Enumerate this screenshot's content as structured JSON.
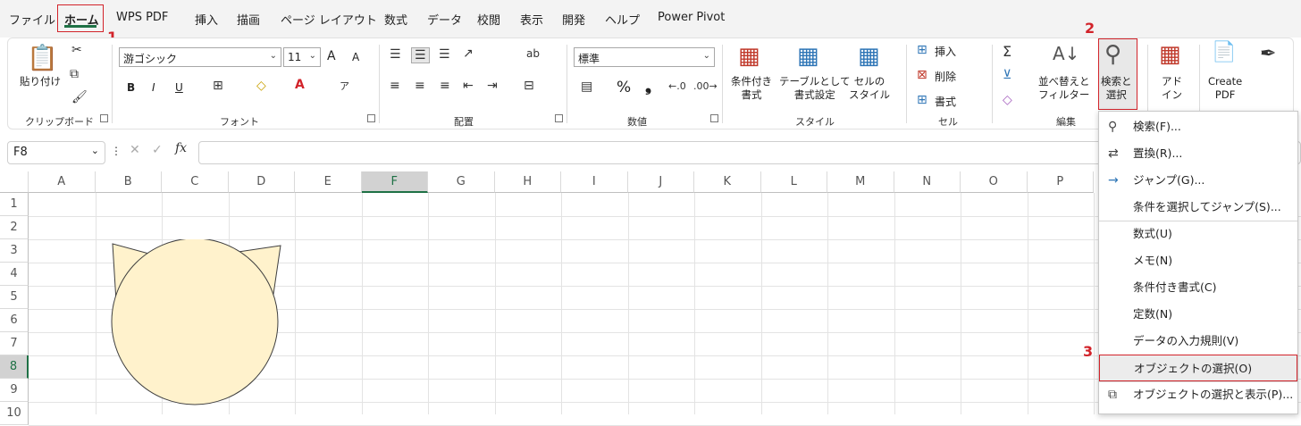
{
  "menu": {
    "tabs": [
      "ファイル",
      "ホーム",
      "WPS PDF",
      "挿入",
      "描画",
      "ページ レイアウト",
      "数式",
      "データ",
      "校閲",
      "表示",
      "開発",
      "ヘルプ",
      "Power Pivot"
    ]
  },
  "annotations": {
    "step1": "1",
    "step2": "2",
    "step3": "3"
  },
  "ribbon": {
    "clipboard": {
      "paste": "貼り付け",
      "group": "クリップボード"
    },
    "font": {
      "name": "游ゴシック",
      "size": "11",
      "bold": "B",
      "italic": "I",
      "underline": "U",
      "grow": "A",
      "shrink": "A",
      "group": "フォント"
    },
    "alignment": {
      "group": "配置"
    },
    "number": {
      "format": "標準",
      "percent": "%",
      "comma": "❟",
      "group": "数値"
    },
    "styles": {
      "cond": "条件付き\n書式",
      "table": "テーブルとして\n書式設定",
      "cell": "セルの\nスタイル",
      "group": "スタイル"
    },
    "cells": {
      "insert": "挿入",
      "delete": "削除",
      "format": "書式",
      "group": "セル"
    },
    "editing": {
      "sort": "並べ替えと\nフィルター",
      "find": "検索と\n選択",
      "group": "編集"
    },
    "addins": {
      "label": "アド\nイン"
    },
    "pdf": {
      "label": "Create\nPDF"
    }
  },
  "formula_bar": {
    "cell_ref": "F8",
    "fx": "fx",
    "value": ""
  },
  "grid": {
    "columns": [
      "A",
      "B",
      "C",
      "D",
      "E",
      "F",
      "G",
      "H",
      "I",
      "J",
      "K",
      "L",
      "M",
      "N",
      "O",
      "P"
    ],
    "rows": [
      "1",
      "2",
      "3",
      "4",
      "5",
      "6",
      "7",
      "8",
      "9",
      "10"
    ],
    "selected_column": "F",
    "selected_row": "8"
  },
  "shape": {
    "fill": "#fff2cc",
    "stroke": "#3f3f3f",
    "name": "cat-face-shape"
  },
  "dropdown": {
    "items": [
      {
        "label": "検索(F)...",
        "icon": "search-icon"
      },
      {
        "label": "置換(R)...",
        "icon": "replace-icon"
      },
      {
        "label": "ジャンプ(G)...",
        "icon": "arrow-right-icon"
      },
      {
        "label": "条件を選択してジャンプ(S)...",
        "icon": ""
      },
      {
        "label": "数式(U)",
        "icon": ""
      },
      {
        "label": "メモ(N)",
        "icon": ""
      },
      {
        "label": "条件付き書式(C)",
        "icon": ""
      },
      {
        "label": "定数(N)",
        "icon": ""
      },
      {
        "label": "データの入力規則(V)",
        "icon": ""
      },
      {
        "label": "オブジェクトの選択(O)",
        "icon": ""
      },
      {
        "label": "オブジェクトの選択と表示(P)...",
        "icon": "selection-pane-icon"
      }
    ]
  },
  "colors": {
    "accent_red": "#d2232a",
    "excel_green": "#1e7145"
  }
}
